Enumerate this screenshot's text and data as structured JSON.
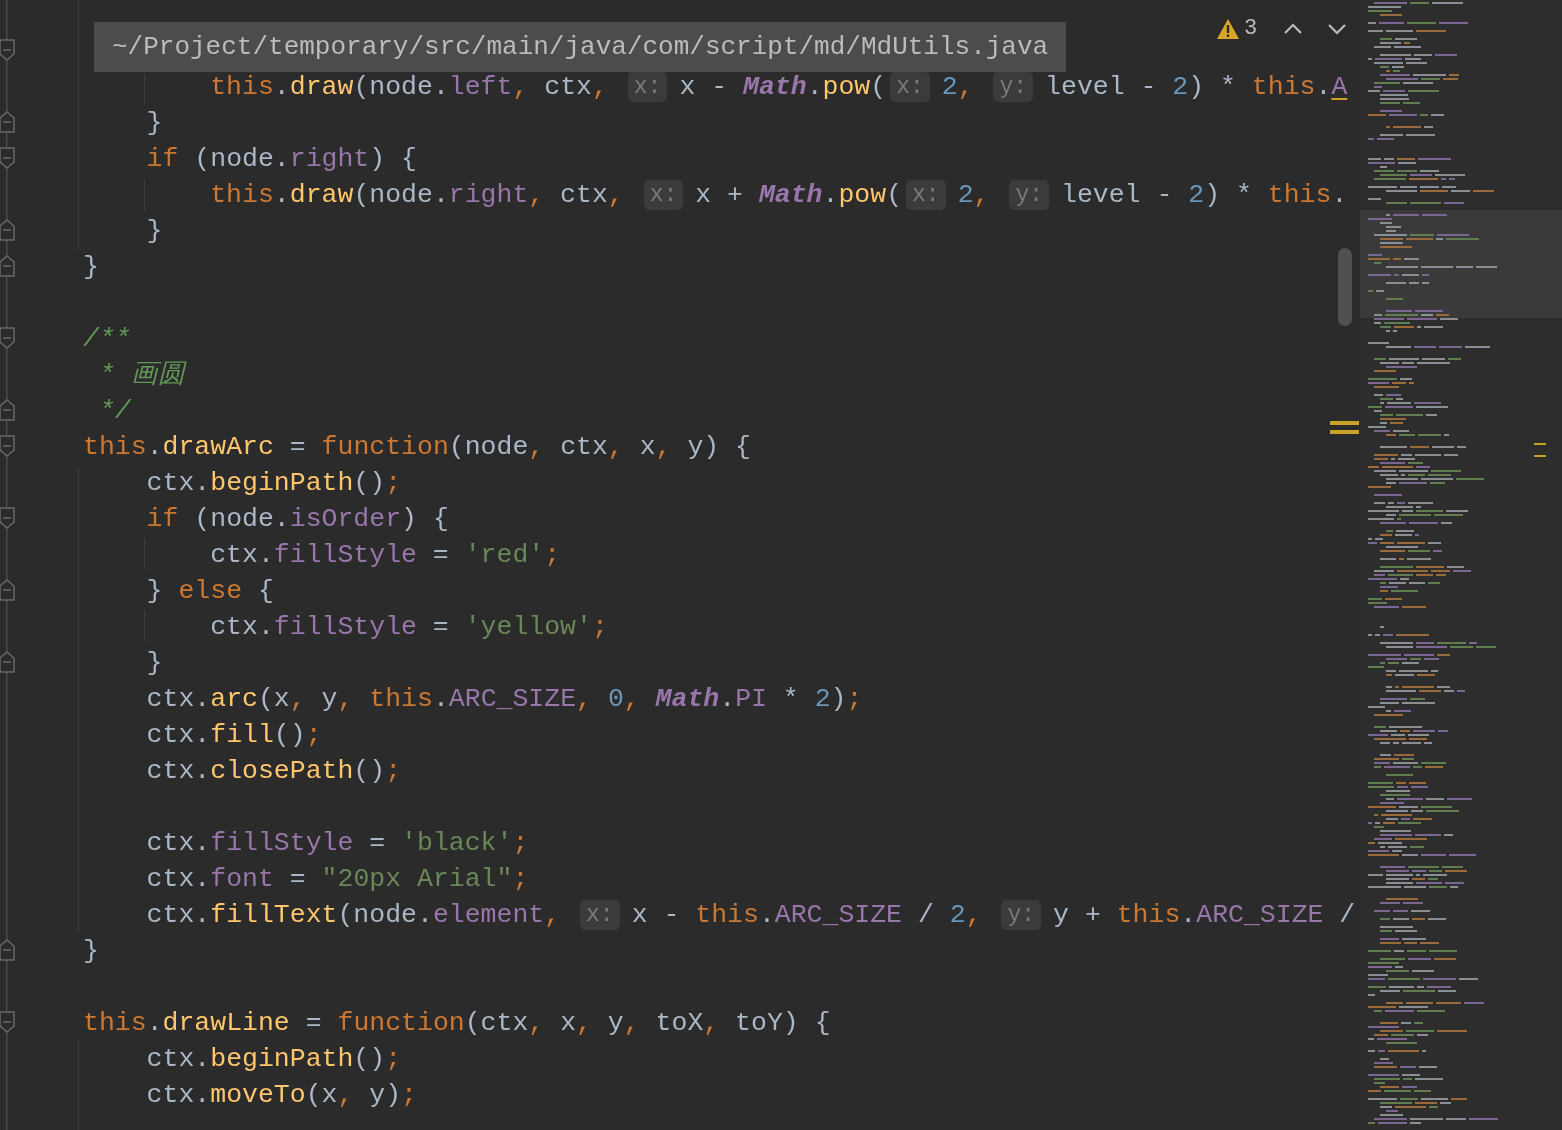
{
  "breadcrumb_tooltip": {
    "text": "~/Project/temporary/src/main/java/com/script/md/MdUtils.java"
  },
  "inspection_widget": {
    "count": "3"
  },
  "lines": [
    {
      "kind": "code",
      "tokens": [
        {
          "kind": "keyword",
          "text": "        this"
        },
        {
          "kind": "plain",
          "text": "."
        },
        {
          "kind": "method",
          "text": "draw"
        },
        {
          "kind": "plain",
          "text": "(node."
        },
        {
          "kind": "field",
          "text": "left"
        },
        {
          "kind": "punct",
          "text": ","
        },
        {
          "kind": "plain",
          "text": " ctx"
        },
        {
          "kind": "punct",
          "text": ", "
        },
        {
          "kind": "hint",
          "text": "x:"
        },
        {
          "kind": "plain",
          "text": "x - "
        },
        {
          "kind": "class",
          "text": "Math"
        },
        {
          "kind": "plain",
          "text": "."
        },
        {
          "kind": "method",
          "text": "pow"
        },
        {
          "kind": "plain",
          "text": "("
        },
        {
          "kind": "hint",
          "text": "x:"
        },
        {
          "kind": "number",
          "text": "2"
        },
        {
          "kind": "punct",
          "text": ", "
        },
        {
          "kind": "hint",
          "text": "y:"
        },
        {
          "kind": "plain",
          "text": "level - "
        },
        {
          "kind": "number",
          "text": "2"
        },
        {
          "kind": "plain",
          "text": ") * "
        },
        {
          "kind": "keyword",
          "text": "this"
        },
        {
          "kind": "plain",
          "text": "."
        },
        {
          "kind": "warning",
          "text": "A"
        }
      ]
    },
    {
      "kind": "code",
      "tokens": [
        {
          "kind": "plain",
          "text": "    }"
        }
      ]
    },
    {
      "kind": "code",
      "tokens": [
        {
          "kind": "keyword",
          "text": "    if"
        },
        {
          "kind": "plain",
          "text": " (node."
        },
        {
          "kind": "field",
          "text": "right"
        },
        {
          "kind": "plain",
          "text": ") {"
        }
      ]
    },
    {
      "kind": "code",
      "tokens": [
        {
          "kind": "keyword",
          "text": "        this"
        },
        {
          "kind": "plain",
          "text": "."
        },
        {
          "kind": "method",
          "text": "draw"
        },
        {
          "kind": "plain",
          "text": "(node."
        },
        {
          "kind": "field",
          "text": "right"
        },
        {
          "kind": "punct",
          "text": ","
        },
        {
          "kind": "plain",
          "text": " ctx"
        },
        {
          "kind": "punct",
          "text": ", "
        },
        {
          "kind": "hint",
          "text": "x:"
        },
        {
          "kind": "plain",
          "text": "x + "
        },
        {
          "kind": "class",
          "text": "Math"
        },
        {
          "kind": "plain",
          "text": "."
        },
        {
          "kind": "method",
          "text": "pow"
        },
        {
          "kind": "plain",
          "text": "("
        },
        {
          "kind": "hint",
          "text": "x:"
        },
        {
          "kind": "number",
          "text": "2"
        },
        {
          "kind": "punct",
          "text": ", "
        },
        {
          "kind": "hint",
          "text": "y:"
        },
        {
          "kind": "plain",
          "text": "level - "
        },
        {
          "kind": "number",
          "text": "2"
        },
        {
          "kind": "plain",
          "text": ") * "
        },
        {
          "kind": "keyword",
          "text": "this"
        },
        {
          "kind": "plain",
          "text": "."
        }
      ]
    },
    {
      "kind": "code",
      "tokens": [
        {
          "kind": "plain",
          "text": "    }"
        }
      ]
    },
    {
      "kind": "code",
      "tokens": [
        {
          "kind": "plain",
          "text": "}"
        }
      ]
    },
    {
      "kind": "blank"
    },
    {
      "kind": "code",
      "tokens": [
        {
          "kind": "comment",
          "text": "/**"
        }
      ]
    },
    {
      "kind": "code",
      "tokens": [
        {
          "kind": "comment",
          "text": " * 画圆"
        }
      ]
    },
    {
      "kind": "code",
      "tokens": [
        {
          "kind": "comment",
          "text": " */"
        }
      ]
    },
    {
      "kind": "code",
      "tokens": [
        {
          "kind": "keyword",
          "text": "this"
        },
        {
          "kind": "plain",
          "text": "."
        },
        {
          "kind": "method",
          "text": "drawArc"
        },
        {
          "kind": "plain",
          "text": " = "
        },
        {
          "kind": "keyword",
          "text": "function"
        },
        {
          "kind": "plain",
          "text": "(node"
        },
        {
          "kind": "punct",
          "text": ","
        },
        {
          "kind": "plain",
          "text": " ctx"
        },
        {
          "kind": "punct",
          "text": ","
        },
        {
          "kind": "plain",
          "text": " x"
        },
        {
          "kind": "punct",
          "text": ","
        },
        {
          "kind": "plain",
          "text": " y) {"
        }
      ]
    },
    {
      "kind": "code",
      "tokens": [
        {
          "kind": "plain",
          "text": "    ctx."
        },
        {
          "kind": "method",
          "text": "beginPath"
        },
        {
          "kind": "plain",
          "text": "()"
        },
        {
          "kind": "punct",
          "text": ";"
        }
      ]
    },
    {
      "kind": "code",
      "tokens": [
        {
          "kind": "keyword",
          "text": "    if"
        },
        {
          "kind": "plain",
          "text": " (node."
        },
        {
          "kind": "field",
          "text": "isOrder"
        },
        {
          "kind": "plain",
          "text": ") {"
        }
      ]
    },
    {
      "kind": "code",
      "tokens": [
        {
          "kind": "plain",
          "text": "        ctx."
        },
        {
          "kind": "field",
          "text": "fillStyle"
        },
        {
          "kind": "plain",
          "text": " = "
        },
        {
          "kind": "string",
          "text": "'red'"
        },
        {
          "kind": "punct",
          "text": ";"
        }
      ]
    },
    {
      "kind": "code",
      "tokens": [
        {
          "kind": "plain",
          "text": "    } "
        },
        {
          "kind": "keyword",
          "text": "else"
        },
        {
          "kind": "plain",
          "text": " {"
        }
      ]
    },
    {
      "kind": "code",
      "tokens": [
        {
          "kind": "plain",
          "text": "        ctx."
        },
        {
          "kind": "field",
          "text": "fillStyle"
        },
        {
          "kind": "plain",
          "text": " = "
        },
        {
          "kind": "string",
          "text": "'yellow'"
        },
        {
          "kind": "punct",
          "text": ";"
        }
      ]
    },
    {
      "kind": "code",
      "tokens": [
        {
          "kind": "plain",
          "text": "    }"
        }
      ]
    },
    {
      "kind": "code",
      "tokens": [
        {
          "kind": "plain",
          "text": "    ctx."
        },
        {
          "kind": "method",
          "text": "arc"
        },
        {
          "kind": "plain",
          "text": "(x"
        },
        {
          "kind": "punct",
          "text": ","
        },
        {
          "kind": "plain",
          "text": " y"
        },
        {
          "kind": "punct",
          "text": ", "
        },
        {
          "kind": "keyword",
          "text": "this"
        },
        {
          "kind": "plain",
          "text": "."
        },
        {
          "kind": "field",
          "text": "ARC_SIZE"
        },
        {
          "kind": "punct",
          "text": ", "
        },
        {
          "kind": "number",
          "text": "0"
        },
        {
          "kind": "punct",
          "text": ", "
        },
        {
          "kind": "class",
          "text": "Math"
        },
        {
          "kind": "plain",
          "text": "."
        },
        {
          "kind": "field",
          "text": "PI"
        },
        {
          "kind": "plain",
          "text": " * "
        },
        {
          "kind": "number",
          "text": "2"
        },
        {
          "kind": "plain",
          "text": ")"
        },
        {
          "kind": "punct",
          "text": ";"
        }
      ]
    },
    {
      "kind": "code",
      "tokens": [
        {
          "kind": "plain",
          "text": "    ctx."
        },
        {
          "kind": "method",
          "text": "fill"
        },
        {
          "kind": "plain",
          "text": "()"
        },
        {
          "kind": "punct",
          "text": ";"
        }
      ]
    },
    {
      "kind": "code",
      "tokens": [
        {
          "kind": "plain",
          "text": "    ctx."
        },
        {
          "kind": "method",
          "text": "closePath"
        },
        {
          "kind": "plain",
          "text": "()"
        },
        {
          "kind": "punct",
          "text": ";"
        }
      ]
    },
    {
      "kind": "blank"
    },
    {
      "kind": "code",
      "tokens": [
        {
          "kind": "plain",
          "text": "    ctx."
        },
        {
          "kind": "field",
          "text": "fillStyle"
        },
        {
          "kind": "plain",
          "text": " = "
        },
        {
          "kind": "string",
          "text": "'black'"
        },
        {
          "kind": "punct",
          "text": ";"
        }
      ]
    },
    {
      "kind": "code",
      "tokens": [
        {
          "kind": "plain",
          "text": "    ctx."
        },
        {
          "kind": "field",
          "text": "font"
        },
        {
          "kind": "plain",
          "text": " = "
        },
        {
          "kind": "string",
          "text": "\"20px Arial\""
        },
        {
          "kind": "punct",
          "text": ";"
        }
      ]
    },
    {
      "kind": "code",
      "tokens": [
        {
          "kind": "plain",
          "text": "    ctx."
        },
        {
          "kind": "method",
          "text": "fillText"
        },
        {
          "kind": "plain",
          "text": "(node."
        },
        {
          "kind": "field",
          "text": "element"
        },
        {
          "kind": "punct",
          "text": ", "
        },
        {
          "kind": "hint",
          "text": "x:"
        },
        {
          "kind": "plain",
          "text": "x - "
        },
        {
          "kind": "keyword",
          "text": "this"
        },
        {
          "kind": "plain",
          "text": "."
        },
        {
          "kind": "field",
          "text": "ARC_SIZE"
        },
        {
          "kind": "plain",
          "text": " / "
        },
        {
          "kind": "number",
          "text": "2"
        },
        {
          "kind": "punct",
          "text": ", "
        },
        {
          "kind": "hint",
          "text": "y:"
        },
        {
          "kind": "plain",
          "text": "y + "
        },
        {
          "kind": "keyword",
          "text": "this"
        },
        {
          "kind": "plain",
          "text": "."
        },
        {
          "kind": "field",
          "text": "ARC_SIZE"
        },
        {
          "kind": "plain",
          "text": " /"
        }
      ]
    },
    {
      "kind": "code",
      "tokens": [
        {
          "kind": "plain",
          "text": "}"
        }
      ]
    },
    {
      "kind": "blank"
    },
    {
      "kind": "code",
      "tokens": [
        {
          "kind": "keyword",
          "text": "this"
        },
        {
          "kind": "plain",
          "text": "."
        },
        {
          "kind": "method",
          "text": "drawLine"
        },
        {
          "kind": "plain",
          "text": " = "
        },
        {
          "kind": "keyword",
          "text": "function"
        },
        {
          "kind": "plain",
          "text": "(ctx"
        },
        {
          "kind": "punct",
          "text": ","
        },
        {
          "kind": "plain",
          "text": " x"
        },
        {
          "kind": "punct",
          "text": ","
        },
        {
          "kind": "plain",
          "text": " y"
        },
        {
          "kind": "punct",
          "text": ","
        },
        {
          "kind": "plain",
          "text": " toX"
        },
        {
          "kind": "punct",
          "text": ","
        },
        {
          "kind": "plain",
          "text": " toY) {"
        }
      ]
    },
    {
      "kind": "code",
      "tokens": [
        {
          "kind": "plain",
          "text": "    ctx."
        },
        {
          "kind": "method",
          "text": "beginPath"
        },
        {
          "kind": "plain",
          "text": "()"
        },
        {
          "kind": "punct",
          "text": ";"
        }
      ]
    },
    {
      "kind": "code",
      "tokens": [
        {
          "kind": "plain",
          "text": "    ctx."
        },
        {
          "kind": "method",
          "text": "moveTo"
        },
        {
          "kind": "plain",
          "text": "(x"
        },
        {
          "kind": "punct",
          "text": ","
        },
        {
          "kind": "plain",
          "text": " y)"
        },
        {
          "kind": "punct",
          "text": ";"
        }
      ]
    }
  ]
}
